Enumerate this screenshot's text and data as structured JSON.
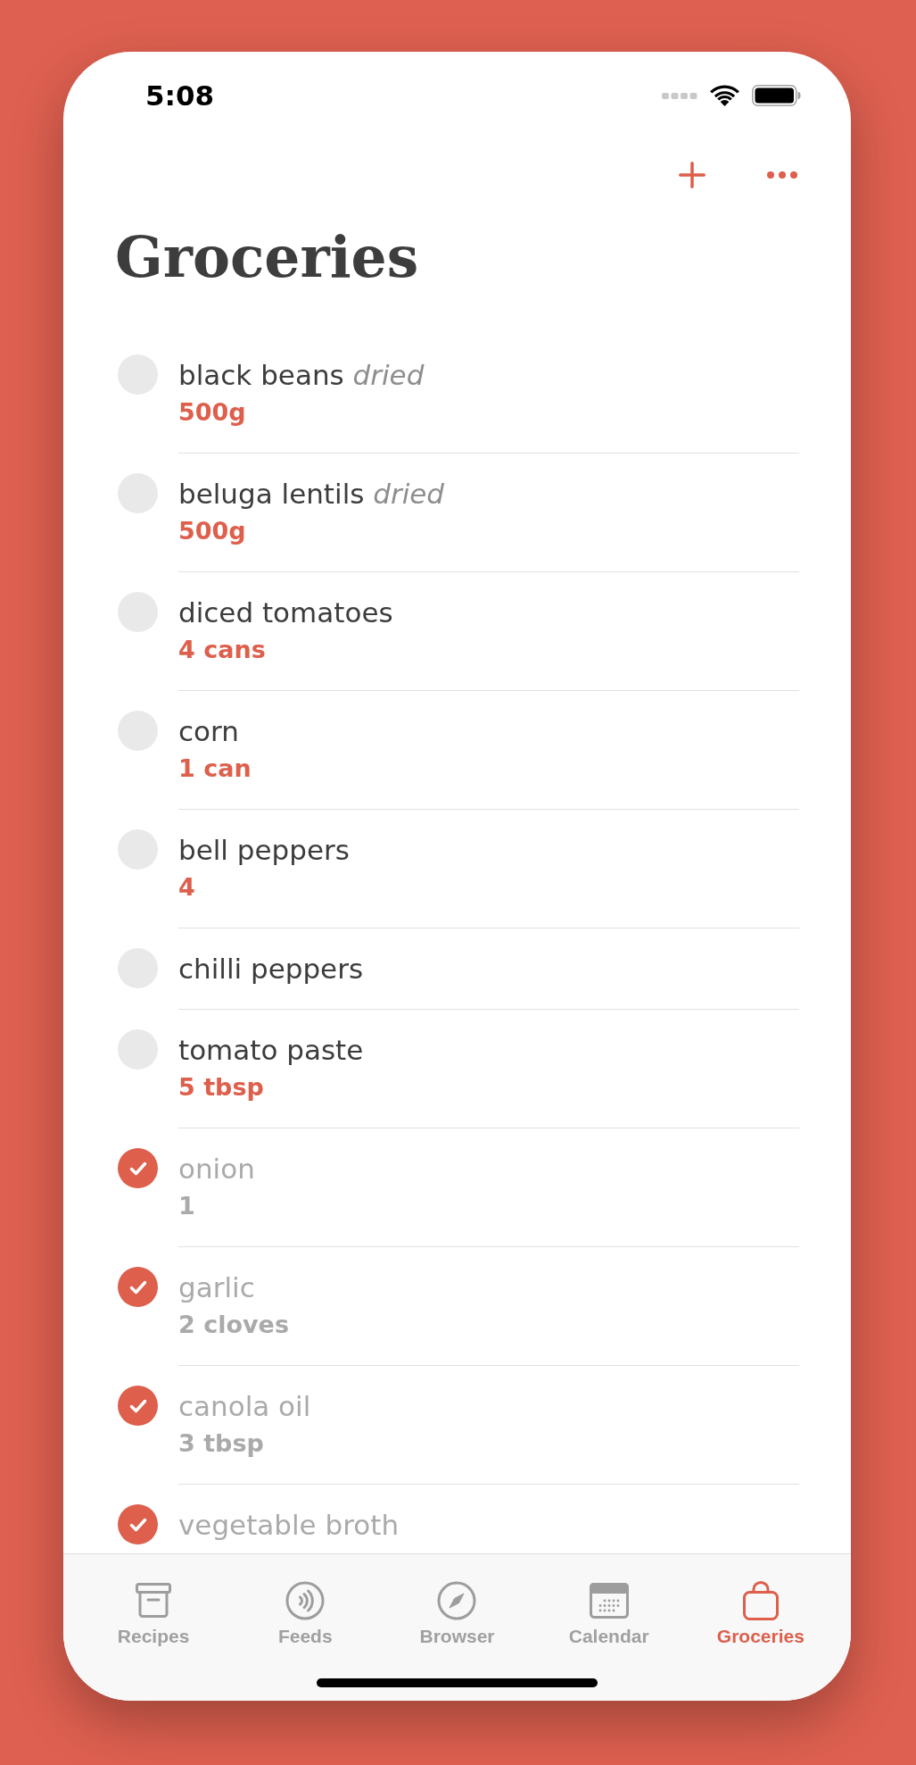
{
  "status_bar": {
    "time": "5:08"
  },
  "title": "Groceries",
  "items": [
    {
      "name": "black beans",
      "note": "dried",
      "quantity": "500g",
      "checked": false
    },
    {
      "name": "beluga lentils",
      "note": "dried",
      "quantity": "500g",
      "checked": false
    },
    {
      "name": "diced tomatoes",
      "quantity": "4 cans",
      "checked": false
    },
    {
      "name": "corn",
      "quantity": "1 can",
      "checked": false
    },
    {
      "name": "bell peppers",
      "quantity": "4",
      "checked": false
    },
    {
      "name": "chilli peppers",
      "checked": false
    },
    {
      "name": "tomato paste",
      "quantity": "5 tbsp",
      "checked": false
    },
    {
      "name": "onion",
      "quantity": "1",
      "checked": true
    },
    {
      "name": "garlic",
      "quantity": "2 cloves",
      "checked": true
    },
    {
      "name": "canola oil",
      "quantity": "3 tbsp",
      "checked": true
    },
    {
      "name": "vegetable broth",
      "checked": true
    }
  ],
  "tabs": [
    {
      "label": "Recipes",
      "selected": false
    },
    {
      "label": "Feeds",
      "selected": false
    },
    {
      "label": "Browser",
      "selected": false
    },
    {
      "label": "Calendar",
      "selected": false
    },
    {
      "label": "Groceries",
      "selected": true
    }
  ]
}
